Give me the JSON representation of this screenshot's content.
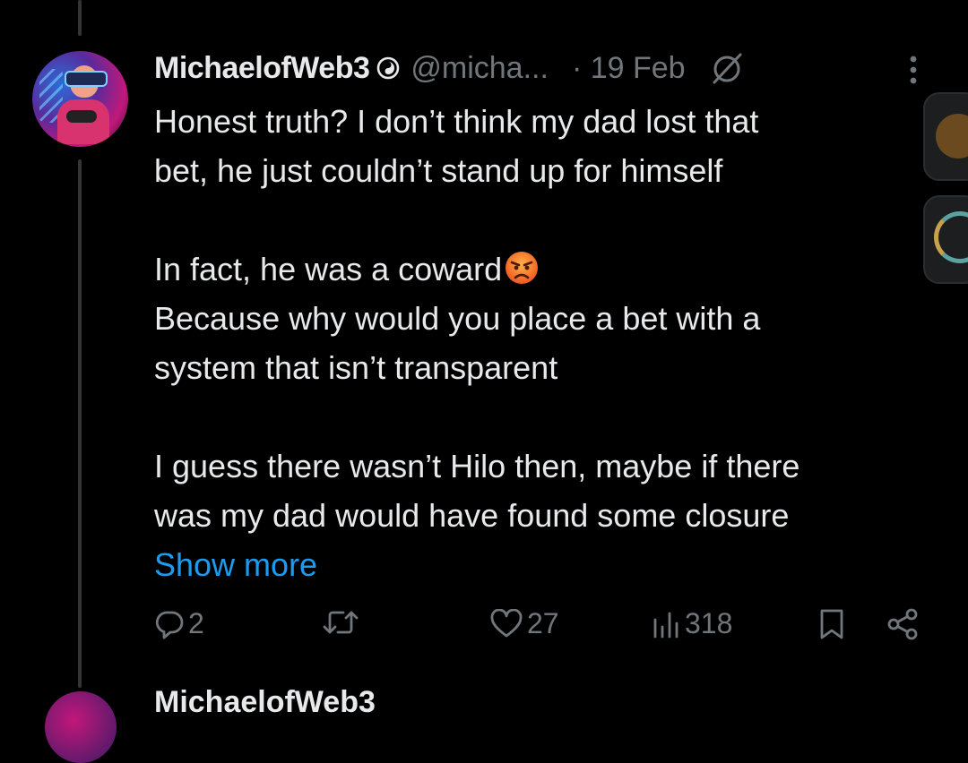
{
  "tweet": {
    "author_name": "MichaelofWeb3",
    "handle": "@micha...",
    "date": "· 19 Feb",
    "paragraphs": [
      {
        "line1": "Honest truth? I don’t think my dad lost that",
        "line2": "bet, he just couldn’t stand up for himself"
      },
      {
        "line1": "In fact, he was a coward",
        "line2": "Because why would you place a bet with a",
        "line3": "system that isn’t transparent"
      },
      {
        "line1": "I guess there wasn’t Hilo then, maybe if there",
        "line2": "was my dad would have found some closure"
      }
    ],
    "show_more": "Show more",
    "emoji": "angry-face",
    "actions": {
      "replies": "2",
      "reposts": "",
      "likes": "27",
      "views": "318"
    }
  },
  "next_tweet": {
    "author_name_partial": "MichaelofWeb3"
  },
  "colors": {
    "background": "#000000",
    "text": "#e7e9ea",
    "secondary": "#71767b",
    "link": "#1d9bf0"
  }
}
